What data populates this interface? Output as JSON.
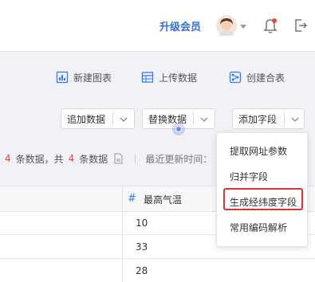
{
  "header": {
    "upgrade_label": "升级会员"
  },
  "toolbar": {
    "new_chart": "新建图表",
    "upload_data": "上传数据",
    "create_merge": "创建合表"
  },
  "selects": {
    "append_data": "追加数据",
    "replace_data": "替换数据",
    "add_field": "添加字段"
  },
  "info": {
    "count_a": "4",
    "text_a": "条数据，共",
    "count_b": "4",
    "text_b": "条数据",
    "updated": "最近更新时间："
  },
  "table": {
    "column_type_icon": "#",
    "column_label": "最高气温",
    "rows": [
      "10",
      "33",
      "28"
    ]
  },
  "dropdown": {
    "items": [
      "提取网址参数",
      "归并字段",
      "生成经纬度字段",
      "常用编码解析"
    ],
    "highlighted_index": 2
  },
  "colors": {
    "accent": "#3370d6",
    "highlight": "#d6362d",
    "count": "#e8453c"
  }
}
